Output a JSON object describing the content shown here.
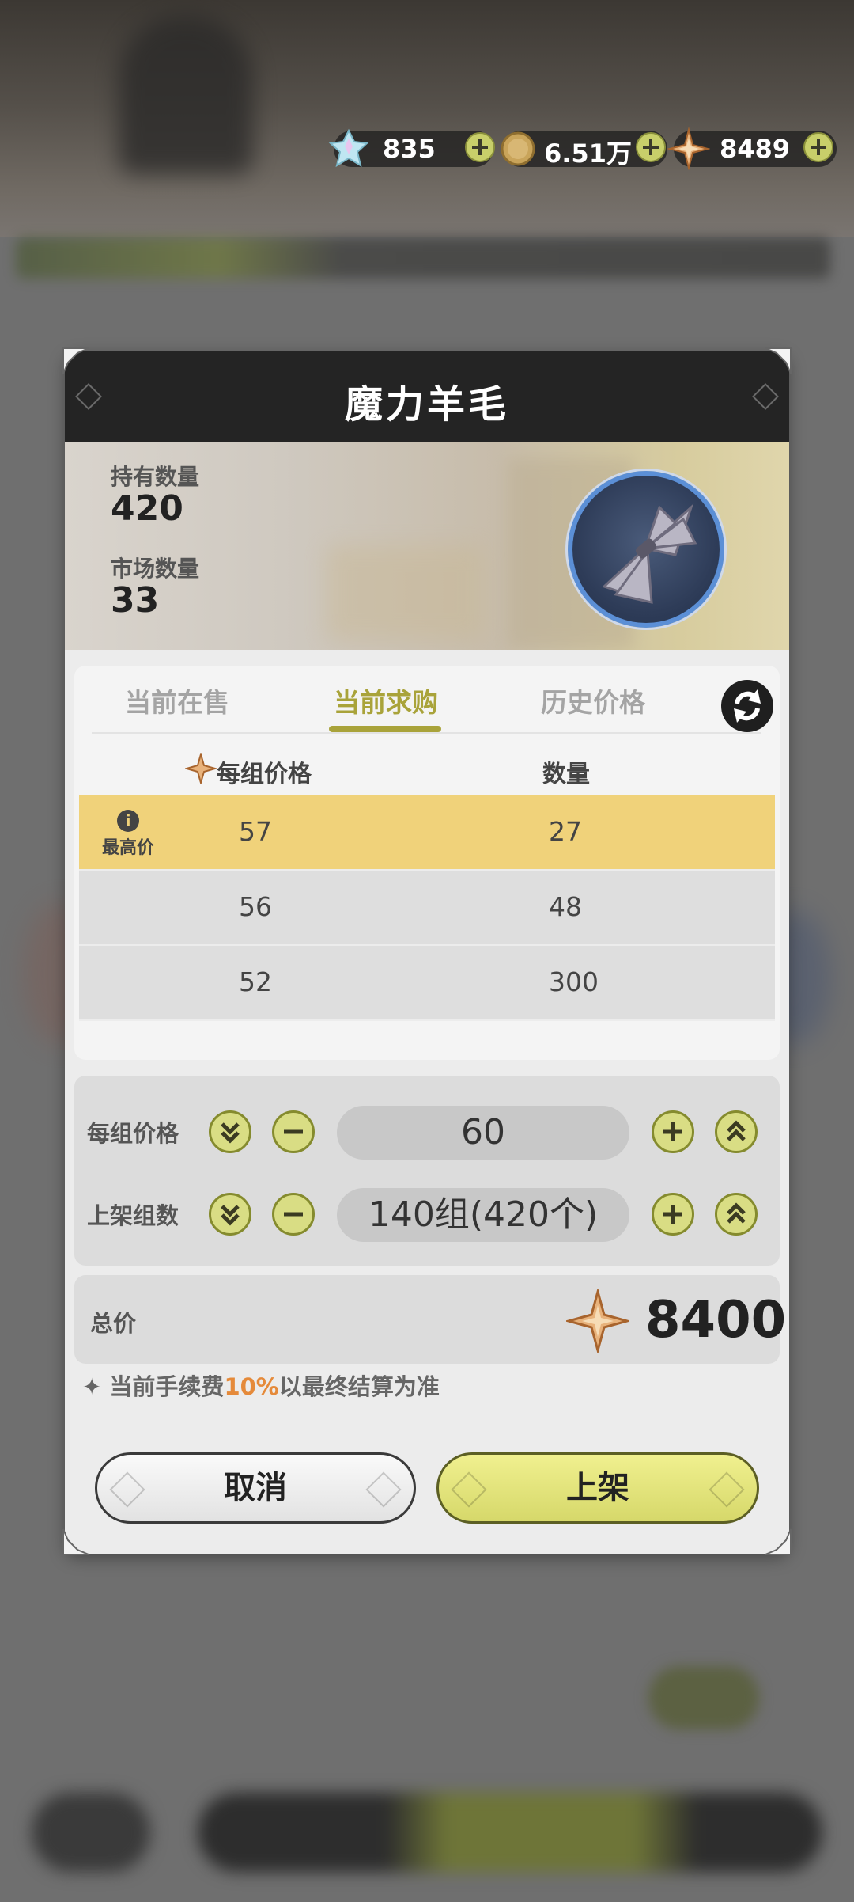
{
  "currencies": [
    {
      "name": "crystal",
      "icon": "crystal-icon",
      "value": "835"
    },
    {
      "name": "gold-coin",
      "icon": "coin-icon",
      "value": "6.51万"
    },
    {
      "name": "star-gem",
      "icon": "star-gem-icon",
      "value": "8489"
    }
  ],
  "dialog": {
    "title": "魔力羊毛",
    "owned_label": "持有数量",
    "owned_value": "420",
    "market_label": "市场数量",
    "market_value": "33",
    "item_icon": "wool-bundle-icon"
  },
  "tabs": [
    {
      "label": "当前在售",
      "active": false
    },
    {
      "label": "当前求购",
      "active": true
    },
    {
      "label": "历史价格",
      "active": false
    }
  ],
  "table": {
    "columns": [
      "每组价格",
      "数量"
    ],
    "top_tag": "最高价",
    "rows": [
      {
        "price": "57",
        "qty": "27",
        "highlight": true
      },
      {
        "price": "56",
        "qty": "48",
        "highlight": false
      },
      {
        "price": "52",
        "qty": "300",
        "highlight": false
      }
    ]
  },
  "config": {
    "price_label": "每组价格",
    "price_value": "60",
    "groups_label": "上架组数",
    "groups_value": "140组(420个)"
  },
  "total": {
    "label": "总价",
    "value": "8400"
  },
  "fee": {
    "prefix": "当前手续费",
    "percent": "10%",
    "suffix": "以最终结算为准"
  },
  "buttons": {
    "cancel": "取消",
    "list": "上架"
  },
  "colors": {
    "accent": "#a9a33a",
    "highlight_row": "#f0d27a",
    "fee_percent": "#e58a3a",
    "header": "#242424"
  }
}
